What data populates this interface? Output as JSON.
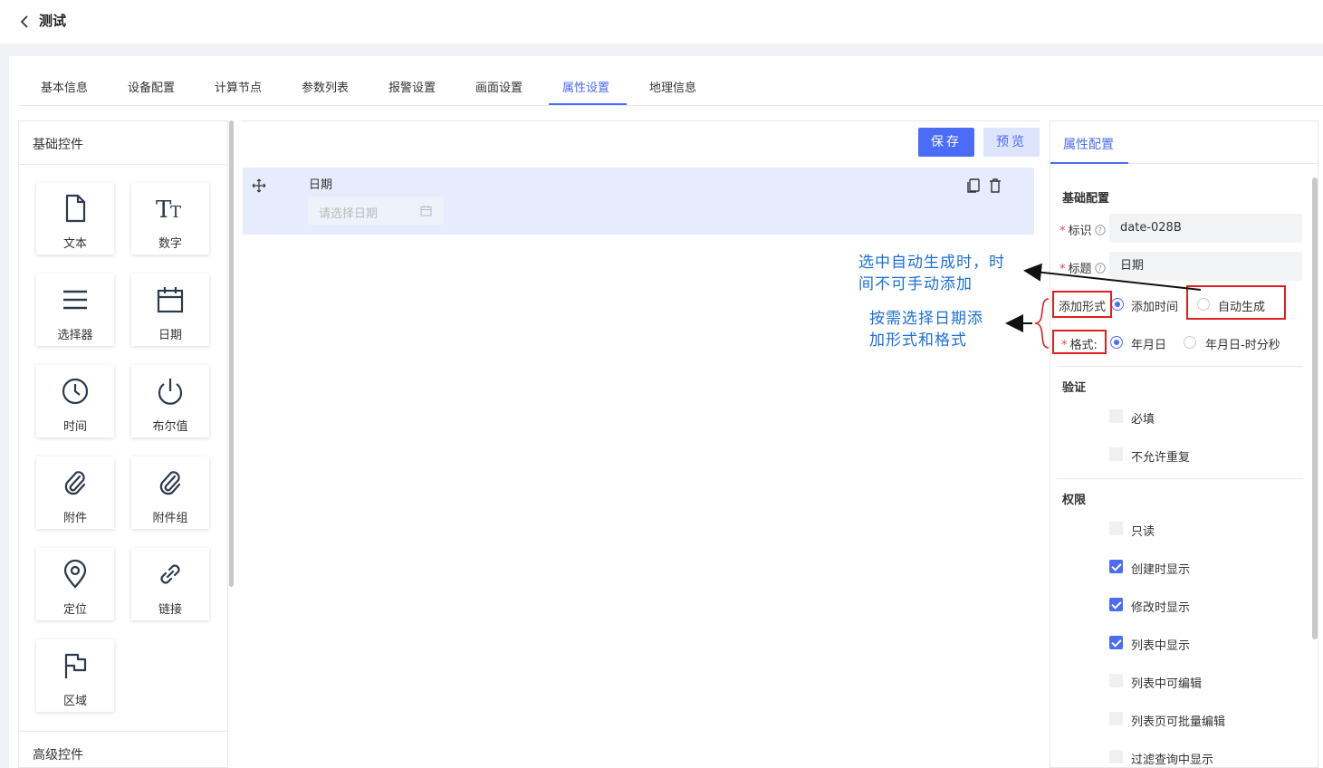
{
  "header": {
    "title": "测试"
  },
  "tabs": [
    {
      "label": "基本信息"
    },
    {
      "label": "设备配置"
    },
    {
      "label": "计算节点"
    },
    {
      "label": "参数列表"
    },
    {
      "label": "报警设置"
    },
    {
      "label": "画面设置"
    },
    {
      "label": "属性设置"
    },
    {
      "label": "地理信息"
    }
  ],
  "left": {
    "title": "基础控件",
    "components": [
      {
        "label": "文本",
        "icon": "file-icon"
      },
      {
        "label": "数字",
        "icon": "text-size-icon"
      },
      {
        "label": "选择器",
        "icon": "list-icon"
      },
      {
        "label": "日期",
        "icon": "calendar-icon"
      },
      {
        "label": "时间",
        "icon": "clock-icon"
      },
      {
        "label": "布尔值",
        "icon": "power-icon"
      },
      {
        "label": "附件",
        "icon": "paperclip-icon"
      },
      {
        "label": "附件组",
        "icon": "paperclip-icon"
      },
      {
        "label": "定位",
        "icon": "location-icon"
      },
      {
        "label": "链接",
        "icon": "link-icon"
      },
      {
        "label": "区域",
        "icon": "flag-icon"
      }
    ],
    "advanced_title": "高级控件"
  },
  "canvas": {
    "save_label": "保存",
    "preview_label": "预览",
    "field_label": "日期",
    "date_placeholder": "请选择日期"
  },
  "props": {
    "tab": "属性配置",
    "basic_title": "基础配置",
    "id_label": "标识",
    "id_value": "date-028B",
    "title_label": "标题",
    "title_value": "日期",
    "add_mode_label": "添加形式",
    "add_mode_options": [
      "添加时间",
      "自动生成"
    ],
    "add_mode_selected": "添加时间",
    "format_label": "格式:",
    "format_options": [
      "年月日",
      "年月日-时分秒"
    ],
    "format_selected": "年月日",
    "validation_title": "验证",
    "validation": [
      {
        "label": "必填",
        "checked": false
      },
      {
        "label": "不允许重复",
        "checked": false
      }
    ],
    "permission_title": "权限",
    "permissions": [
      {
        "label": "只读",
        "checked": false
      },
      {
        "label": "创建时显示",
        "checked": true
      },
      {
        "label": "修改时显示",
        "checked": true
      },
      {
        "label": "列表中显示",
        "checked": true
      },
      {
        "label": "列表中可编辑",
        "checked": false
      },
      {
        "label": "列表页可批量编辑",
        "checked": false
      },
      {
        "label": "过滤查询中显示",
        "checked": false
      }
    ]
  },
  "annotations": {
    "note1_line1": "选中自动生成时，时",
    "note1_line2": "间不可手动添加",
    "note2_line1": "按需选择日期添",
    "note2_line2": "加形式和格式"
  },
  "colors": {
    "accent": "#4a6cf7",
    "annotation": "#1a6fd8",
    "highlight": "#e02020"
  }
}
